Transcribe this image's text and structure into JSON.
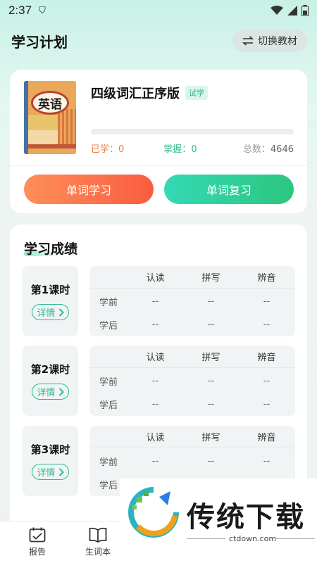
{
  "status_bar": {
    "time": "2:37",
    "shield_glyph": "⛉"
  },
  "header": {
    "title": "学习计划",
    "switch_label": "切换教材"
  },
  "book": {
    "cover_text": "英语",
    "name": "四级词汇正序版",
    "tag": "试学",
    "progress": 0,
    "learned_label": "已学：",
    "learned_value": "0",
    "mastered_label": "掌握：",
    "mastered_value": "0",
    "total_label": "总数：",
    "total_value": "4646"
  },
  "buttons": {
    "study": "单词学习",
    "review": "单词复习"
  },
  "results": {
    "title": "学习成绩",
    "columns": [
      "认读",
      "拼写",
      "辨音"
    ],
    "row_labels": [
      "学前",
      "学后"
    ],
    "lessons": [
      {
        "name": "第1课时",
        "detail": "详情",
        "rows": [
          [
            "--",
            "--",
            "--"
          ],
          [
            "--",
            "--",
            "--"
          ]
        ]
      },
      {
        "name": "第2课时",
        "detail": "详情",
        "rows": [
          [
            "--",
            "--",
            "--"
          ],
          [
            "--",
            "--",
            "--"
          ]
        ]
      },
      {
        "name": "第3课时",
        "detail": "详情",
        "rows": [
          [
            "--",
            "--",
            "--"
          ],
          [
            "--",
            "--",
            "--"
          ]
        ]
      }
    ]
  },
  "nav": {
    "report": "报告",
    "wordbook": "生词本"
  },
  "watermark": {
    "text": "传统下载",
    "url": "ctdown.com"
  },
  "colors": {
    "accent_green": "#2fb98f",
    "accent_orange": "#f07b3f"
  }
}
